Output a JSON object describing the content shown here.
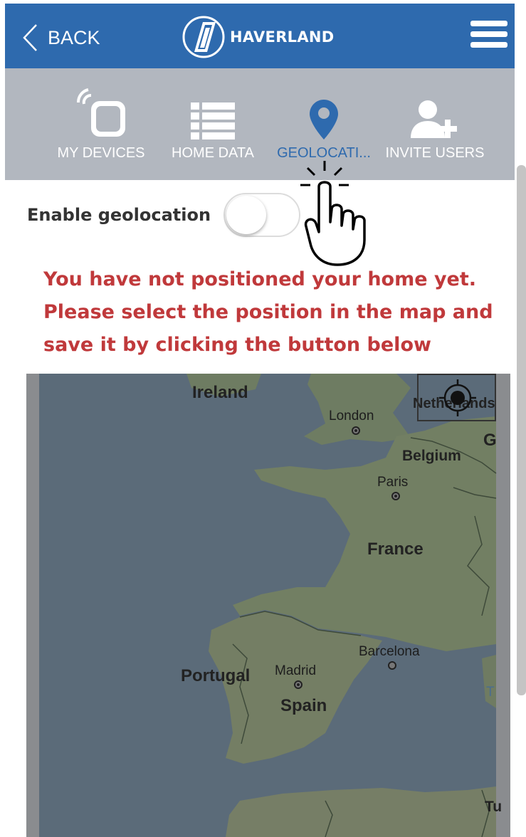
{
  "header": {
    "back_label": "BACK",
    "brand": "HAVERLAND",
    "background": "#2e6aae"
  },
  "tabs": [
    {
      "label": "MY DEVICES",
      "icon": "wifi-device-icon",
      "active": false
    },
    {
      "label": "HOME DATA",
      "icon": "list-icon",
      "active": false
    },
    {
      "label": "GEOLOCATI...",
      "icon": "location-pin-icon",
      "active": true
    },
    {
      "label": "INVITE USERS",
      "icon": "add-user-icon",
      "active": false
    }
  ],
  "geolocation": {
    "label": "Enable geolocation",
    "enabled": false
  },
  "warning": {
    "text": "You have not positioned your home yet. Please select the position in the map and save it by clicking the button below",
    "color": "#c0393b"
  },
  "map": {
    "countries": {
      "ireland": "Ireland",
      "netherlands": "Netherlands",
      "belgium": "Belgium",
      "germany_fragment": "G",
      "france": "France",
      "portugal": "Portugal",
      "spain": "Spain",
      "right_fragment": "T",
      "bottom_fragment": "Tu"
    },
    "cities": {
      "london": "London",
      "paris": "Paris",
      "barcelona": "Barcelona",
      "madrid": "Madrid"
    }
  },
  "colors": {
    "accent": "#2e6aae",
    "tabbar": "#b2b7bf",
    "active_tab": "#2e6aae"
  }
}
